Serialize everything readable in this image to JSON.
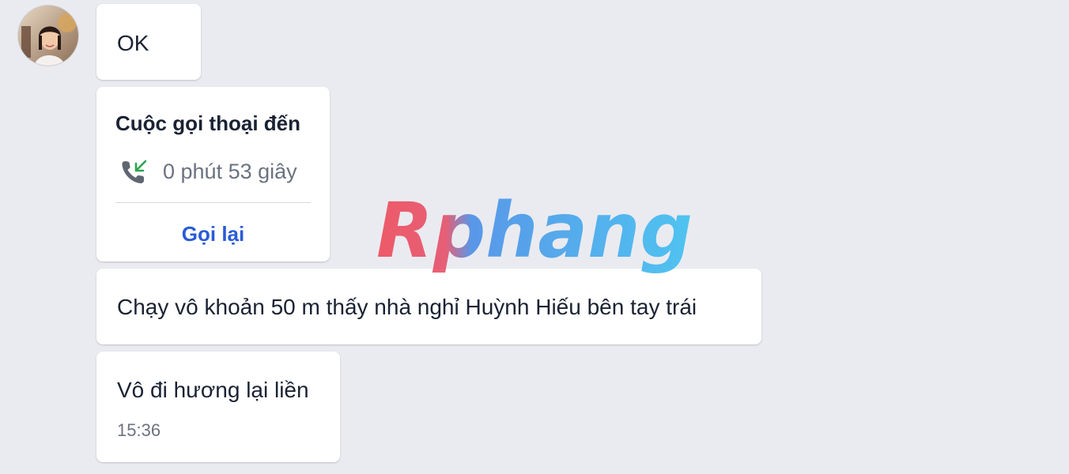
{
  "messages": [
    {
      "text": "OK"
    },
    {
      "type": "call",
      "title": "Cuộc gọi thoại đến",
      "duration": "0 phút 53 giây",
      "action_label": "Gọi lại",
      "icon": "incoming-call-icon"
    },
    {
      "text": "Chạy vô khoản 50 m thấy nhà nghỉ Huỳnh Hiếu bên tay trái"
    },
    {
      "text": "Vô đi hương lại liền",
      "time": "15:36"
    }
  ],
  "watermark": {
    "text": "Rphang"
  },
  "colors": {
    "background": "#eaebf0",
    "bubble": "#ffffff",
    "link": "#2a5bd7",
    "muted": "#6b7280",
    "incoming_arrow": "#2ea44f"
  }
}
